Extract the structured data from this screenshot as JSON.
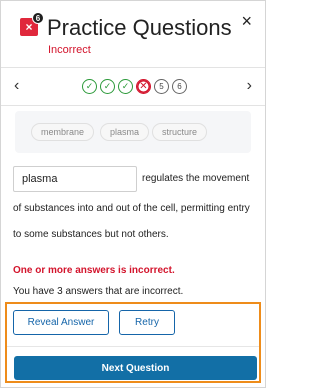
{
  "header": {
    "title": "Practice Questions",
    "status": "Incorrect",
    "app_badge": "6",
    "app_icon_glyph": "×",
    "close_glyph": "×"
  },
  "pager": {
    "prev_glyph": "‹",
    "next_glyph": "›",
    "questions": [
      {
        "state": "correct",
        "label": "✓"
      },
      {
        "state": "correct",
        "label": "✓"
      },
      {
        "state": "correct",
        "label": "✓"
      },
      {
        "state": "incorrect",
        "label": "✕"
      },
      {
        "state": "pending",
        "label": "5"
      },
      {
        "state": "pending",
        "label": "6"
      }
    ]
  },
  "word_bank": [
    "membrane",
    "plasma",
    "structure"
  ],
  "question": {
    "answer_value": "plasma",
    "text_line1": "regulates the movement",
    "text_line2": "of substances into and out of the cell, permitting entry",
    "text_line3": "to some substances but not others."
  },
  "feedback": {
    "error": "One or more answers is incorrect.",
    "summary": "You have 3 answers that are incorrect."
  },
  "actions": {
    "reveal_label": "Reveal Answer",
    "retry_label": "Retry",
    "next_label": "Next Question"
  },
  "colors": {
    "error_red": "#d3142c",
    "correct_green": "#2c9a3a",
    "primary_blue": "#126fa6",
    "highlight_orange": "#ee8c1a"
  }
}
